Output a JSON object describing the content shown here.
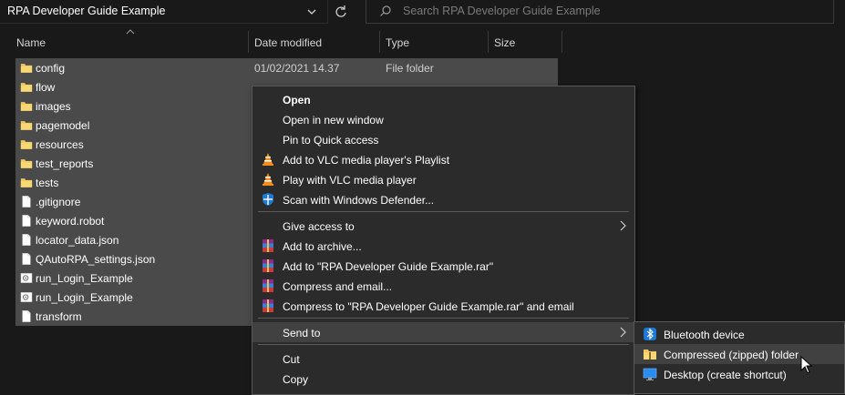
{
  "address": {
    "path": "RPA Developer Guide Example"
  },
  "search": {
    "placeholder": "Search RPA Developer Guide Example"
  },
  "columns": {
    "name": "Name",
    "date": "Date modified",
    "type": "Type",
    "size": "Size"
  },
  "files": [
    {
      "name": "config",
      "date": "01/02/2021 14.37",
      "type": "File folder",
      "icon": "folder-icon"
    },
    {
      "name": "flow",
      "date": "",
      "type": "",
      "icon": "folder-icon"
    },
    {
      "name": "images",
      "date": "",
      "type": "",
      "icon": "folder-icon"
    },
    {
      "name": "pagemodel",
      "date": "",
      "type": "",
      "icon": "folder-icon"
    },
    {
      "name": "resources",
      "date": "",
      "type": "",
      "icon": "folder-icon"
    },
    {
      "name": "test_reports",
      "date": "",
      "type": "",
      "icon": "folder-icon"
    },
    {
      "name": "tests",
      "date": "",
      "type": "",
      "icon": "folder-icon"
    },
    {
      "name": ".gitignore",
      "date": "",
      "type": "",
      "icon": "file-icon"
    },
    {
      "name": "keyword.robot",
      "date": "",
      "type": "",
      "icon": "file-icon"
    },
    {
      "name": "locator_data.json",
      "date": "",
      "type": "",
      "icon": "file-icon"
    },
    {
      "name": "QAutoRPA_settings.json",
      "date": "",
      "type": "",
      "icon": "file-icon"
    },
    {
      "name": "run_Login_Example",
      "date": "",
      "type": "",
      "icon": "settings-file-icon"
    },
    {
      "name": "run_Login_Example",
      "date": "",
      "type": "",
      "icon": "settings-file-icon"
    },
    {
      "name": "transform",
      "date": "",
      "type": "",
      "icon": "file-icon"
    }
  ],
  "context_menu": {
    "items": [
      {
        "label": "Open",
        "icon": ""
      },
      {
        "label": "Open in new window",
        "icon": ""
      },
      {
        "label": "Pin to Quick access",
        "icon": ""
      },
      {
        "label": "Add to VLC media player's Playlist",
        "icon": "vlc-icon"
      },
      {
        "label": "Play with VLC media player",
        "icon": "vlc-icon"
      },
      {
        "label": "Scan with Windows Defender...",
        "icon": "windows-defender-icon"
      },
      {
        "label": "Give access to",
        "icon": ""
      },
      {
        "label": "Add to archive...",
        "icon": "winrar-icon"
      },
      {
        "label": "Add to \"RPA Developer Guide Example.rar\"",
        "icon": "winrar-icon"
      },
      {
        "label": "Compress and email...",
        "icon": "winrar-icon"
      },
      {
        "label": "Compress to \"RPA Developer Guide Example.rar\" and email",
        "icon": "winrar-icon"
      },
      {
        "label": "Send to",
        "icon": ""
      },
      {
        "label": "Cut",
        "icon": ""
      },
      {
        "label": "Copy",
        "icon": ""
      }
    ]
  },
  "send_to_menu": {
    "items": [
      {
        "label": "Bluetooth device",
        "icon": "bluetooth-icon"
      },
      {
        "label": "Compressed (zipped) folder",
        "icon": "zip-folder-icon"
      },
      {
        "label": "Desktop (create shortcut)",
        "icon": "desktop-icon"
      }
    ]
  },
  "colors": {
    "background": "#191919",
    "selection": "#4a4a4a",
    "menu_bg": "#2b2b2b",
    "menu_hover": "#414141",
    "folder": "#f2c45a"
  }
}
